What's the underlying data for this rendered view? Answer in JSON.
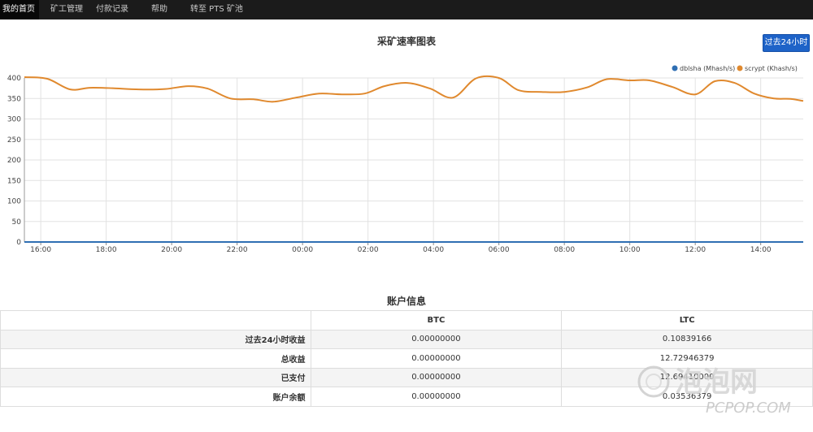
{
  "nav": {
    "items": [
      {
        "label": "我的首页",
        "active": true
      },
      {
        "label": "矿工管理"
      },
      {
        "label": "付款记录"
      },
      {
        "label": "帮助"
      },
      {
        "label": "转至 PTS 矿池"
      }
    ]
  },
  "chart": {
    "title": "采矿速率图表",
    "range_button": "过去24小时"
  },
  "chart_data": {
    "type": "line",
    "title": "采矿速率图表",
    "series": [
      {
        "name": "dblsha (Mhash/s)",
        "color": "#2f6fb3",
        "values": [
          0,
          0,
          0,
          0,
          0,
          0,
          0,
          0,
          0,
          0,
          0,
          0,
          0,
          0,
          0,
          0,
          0,
          0,
          0,
          0,
          0,
          0,
          0,
          0
        ]
      },
      {
        "name": "scrypt (Khash/s)",
        "color": "#e0892e",
        "values": [
          402,
          398,
          372,
          376,
          375,
          372,
          373,
          380,
          374,
          350,
          348,
          342,
          352,
          362,
          360,
          362,
          380,
          388,
          374,
          352,
          399,
          400,
          370,
          366,
          366,
          377,
          397,
          394,
          394,
          378,
          360,
          392,
          388,
          362,
          350,
          349,
          344
        ]
      }
    ],
    "x": [
      15.5,
      16.2,
      16.9,
      17.5,
      18.2,
      19.0,
      19.8,
      20.5,
      21.1,
      21.8,
      22.5,
      23.1,
      23.8,
      24.5,
      25.2,
      25.9,
      26.5,
      27.2,
      27.9,
      28.6,
      29.3,
      30.0,
      30.6,
      31.3,
      32.0,
      32.7,
      33.3,
      34.0,
      34.6,
      35.3,
      36.0,
      36.6,
      37.2,
      37.8,
      38.4,
      38.9,
      39.3
    ],
    "x_ticks": [
      "16:00",
      "18:00",
      "20:00",
      "22:00",
      "00:00",
      "02:00",
      "04:00",
      "06:00",
      "08:00",
      "10:00",
      "12:00",
      "14:00"
    ],
    "y_ticks": [
      "0",
      "50",
      "100",
      "150",
      "200",
      "250",
      "300",
      "350",
      "400"
    ],
    "ylim": [
      0,
      400
    ],
    "xlim": [
      15.5,
      39.3
    ],
    "grid": true,
    "legend_position": "top-right"
  },
  "account": {
    "title": "账户信息",
    "columns": [
      "",
      "BTC",
      "LTC"
    ],
    "rows": [
      {
        "label": "过去24小时收益",
        "btc": "0.00000000",
        "ltc": "0.10839166"
      },
      {
        "label": "总收益",
        "btc": "0.00000000",
        "ltc": "12.72946379"
      },
      {
        "label": "已支付",
        "btc": "0.00000000",
        "ltc": "12.69410000"
      },
      {
        "label": "账户余额",
        "btc": "0.00000000",
        "ltc": "0.03536379"
      }
    ]
  },
  "watermark": {
    "text": "泡泡网",
    "sub": "PCPOP.COM"
  }
}
